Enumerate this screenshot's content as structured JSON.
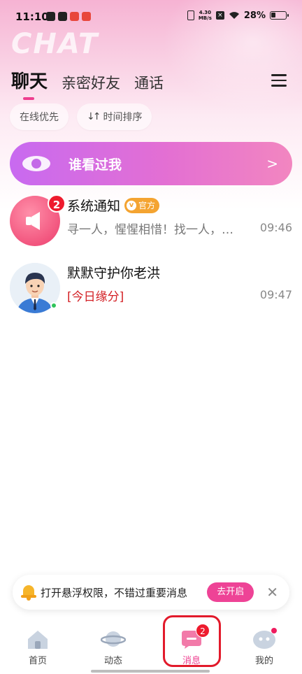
{
  "status_bar": {
    "time": "11:10",
    "net_speed_top": "4.30",
    "net_speed_bottom": "MB/s",
    "battery": "28%"
  },
  "header": {
    "watermark": "CHAT",
    "tabs": [
      {
        "label": "聊天",
        "active": true
      },
      {
        "label": "亲密好友",
        "active": false
      },
      {
        "label": "通话",
        "active": false
      }
    ]
  },
  "filters": {
    "online_first": "在线优先",
    "time_sort": "时间排序"
  },
  "banner": {
    "label": "谁看过我",
    "arrow": ">"
  },
  "chats": [
    {
      "name": "系统通知",
      "official_tag": "官方",
      "official_icon_text": "v",
      "preview": "寻一人，惺惺相惜！找一人，…",
      "time": "09:46",
      "badge": "2"
    },
    {
      "name": "默默守护你老洪",
      "preview": "[今日缘分]",
      "time": "09:47"
    }
  ],
  "notice": {
    "text": "打开悬浮权限，不错过重要消息",
    "button": "去开启",
    "close": "✕"
  },
  "bottom_nav": [
    {
      "label": "首页"
    },
    {
      "label": "动态"
    },
    {
      "label": "消息",
      "badge": "2",
      "active": true
    },
    {
      "label": "我的"
    }
  ],
  "colors": {
    "accent": "#ee3e8f",
    "badge": "#ee1b2e",
    "banner_start": "#c86af0",
    "banner_end": "#f286c0"
  }
}
